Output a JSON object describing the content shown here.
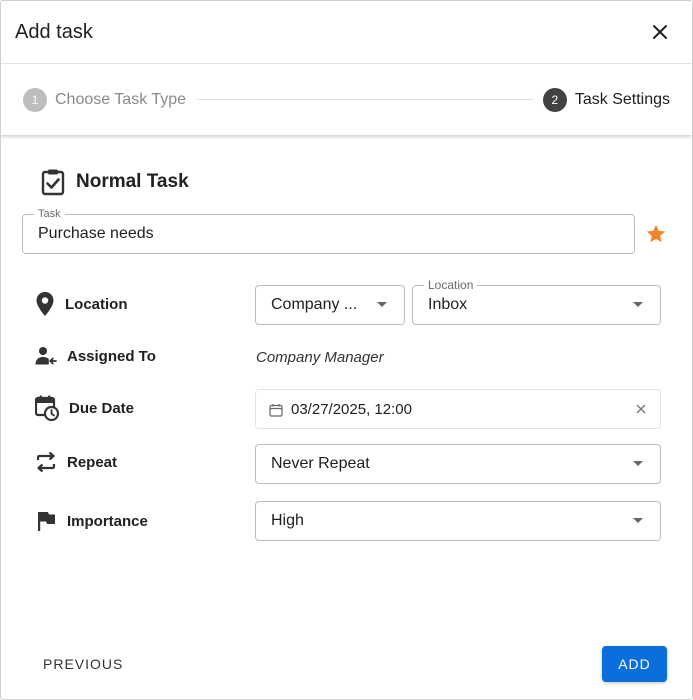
{
  "dialog": {
    "title": "Add task",
    "close_icon": "close-icon"
  },
  "stepper": {
    "steps": [
      {
        "number": "1",
        "label": "Choose Task Type",
        "state": "inactive"
      },
      {
        "number": "2",
        "label": "Task Settings",
        "state": "active"
      }
    ]
  },
  "task_type": {
    "icon": "clipboard-check-icon",
    "name": "Normal Task"
  },
  "task_field": {
    "label": "Task",
    "value": "Purchase needs",
    "star_icon": "star-icon",
    "star_color": "#f0852a"
  },
  "location": {
    "label": "Location",
    "icon": "location-pin-icon",
    "company_value": "Company ...",
    "location_field_label": "Location",
    "location_value": "Inbox"
  },
  "assigned_to": {
    "label": "Assigned To",
    "icon": "assign-user-icon",
    "value": "Company Manager"
  },
  "due_date": {
    "label": "Due Date",
    "icon": "calendar-clock-icon",
    "value": "03/27/2025, 12:00"
  },
  "repeat": {
    "label": "Repeat",
    "icon": "repeat-icon",
    "value": "Never Repeat"
  },
  "importance": {
    "label": "Importance",
    "icon": "flag-icon",
    "value": "High"
  },
  "footer": {
    "previous_label": "PREVIOUS",
    "add_label": "ADD",
    "accent_color": "#0a6fdc"
  }
}
